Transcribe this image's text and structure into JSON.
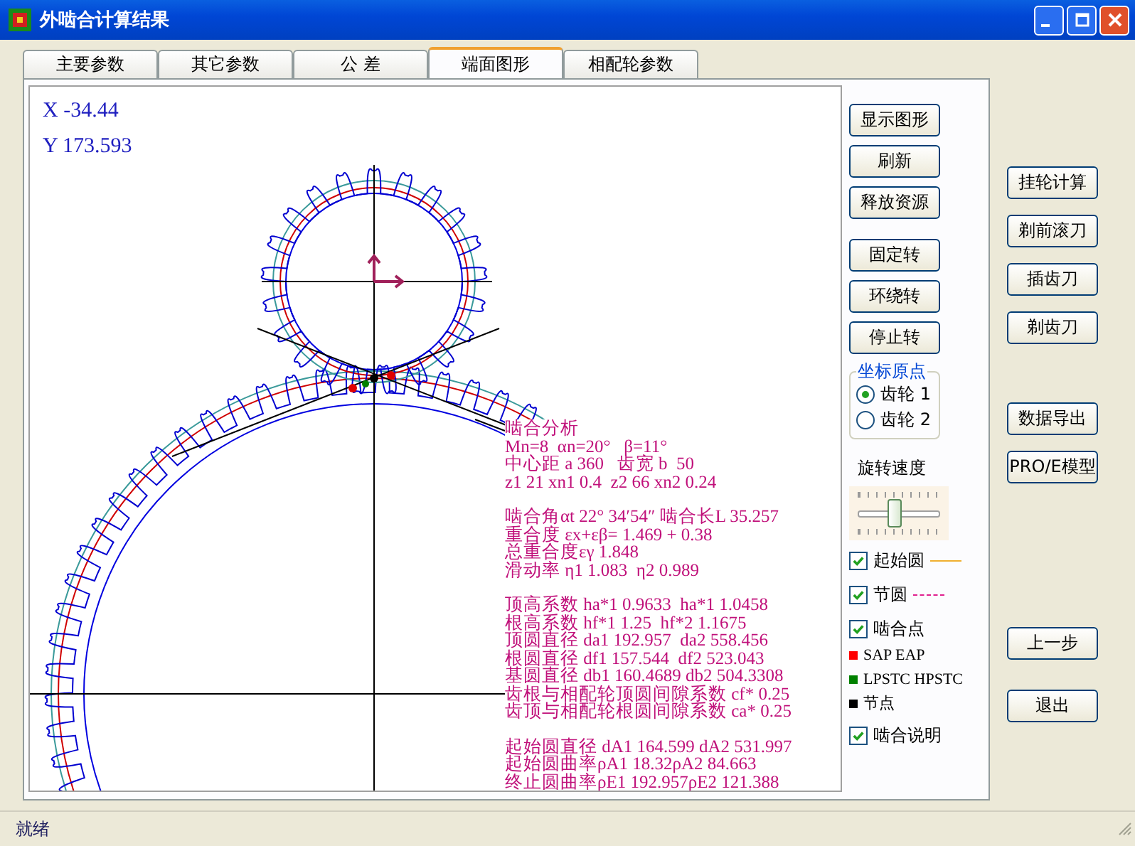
{
  "window": {
    "title": "外啮合计算结果"
  },
  "tabs": [
    {
      "label": "主要参数",
      "selected": false
    },
    {
      "label": "其它参数",
      "selected": false
    },
    {
      "label": "公 差",
      "selected": false
    },
    {
      "label": "端面图形",
      "selected": true
    },
    {
      "label": "相配轮参数",
      "selected": false
    }
  ],
  "coords": [
    "X -34.44",
    "Y 173.593"
  ],
  "analysis": {
    "title": "啮合分析",
    "groups": [
      [
        "Mn=8  αn=20°   β=11°",
        "中心距 a 360   齿宽 b  50",
        "z1 21 xn1 0.4  z2 66 xn2 0.24"
      ],
      [
        "啮合角αt 22° 34′54″ 啮合长L 35.257",
        "重合度 εx+εβ= 1.469 + 0.38",
        "总重合度εγ 1.848",
        "滑动率 η1 1.083  η2 0.989"
      ],
      [
        "顶高系数 ha*1 0.9633  ha*1 1.0458",
        "根高系数 hf*1 1.25  hf*2 1.1675",
        "顶圆直径 da1 192.957  da2 558.456",
        "根圆直径 df1 157.544  df2 523.043",
        "基圆直径 db1 160.4689 db2 504.3308",
        "齿根与相配轮顶圆间隙系数 cf* 0.25",
        "齿顶与相配轮根圆间隙系数 ca* 0.25"
      ],
      [
        "起始圆直径 dA1 164.599 dA2 531.997",
        "起始圆曲率ρA1 18.32ρA2 84.663",
        "终止圆曲率ρE1 192.957ρE2 121.388"
      ]
    ]
  },
  "panel_buttons": [
    [
      "显示图形",
      "刷新",
      "释放资源"
    ],
    [
      "固定转",
      "环绕转",
      "停止转"
    ]
  ],
  "origin": {
    "title": "坐标原点",
    "options": [
      {
        "label": "齿轮 1",
        "selected": true
      },
      {
        "label": "齿轮 2",
        "selected": false
      }
    ]
  },
  "speed": {
    "label": "旋转速度",
    "level": 0.45
  },
  "layers": [
    {
      "kind": "checkbox",
      "label": "起始圆",
      "checked": true,
      "dashed": false,
      "color": "#f0b030"
    },
    {
      "kind": "checkbox",
      "label": "节圆",
      "checked": true,
      "dashed": true,
      "color": "#e0208f"
    },
    {
      "kind": "checkbox",
      "label": "啮合点",
      "checked": true
    },
    {
      "kind": "legend",
      "label": "SAP EAP",
      "color": "#ff0000"
    },
    {
      "kind": "legend",
      "label": "LPSTC HPSTC",
      "color": "#008000"
    },
    {
      "kind": "legend",
      "label": "节点",
      "color": "#000000"
    },
    {
      "kind": "checkbox",
      "label": "啮合说明",
      "checked": true
    }
  ],
  "side_buttons": [
    [
      "挂轮计算",
      "剃前滚刀",
      "插齿刀",
      "剃齿刀"
    ],
    [
      "数据导出",
      "PRO/E模型"
    ],
    [
      "上一步"
    ],
    [
      "退出"
    ]
  ],
  "status_bar": "就绪"
}
